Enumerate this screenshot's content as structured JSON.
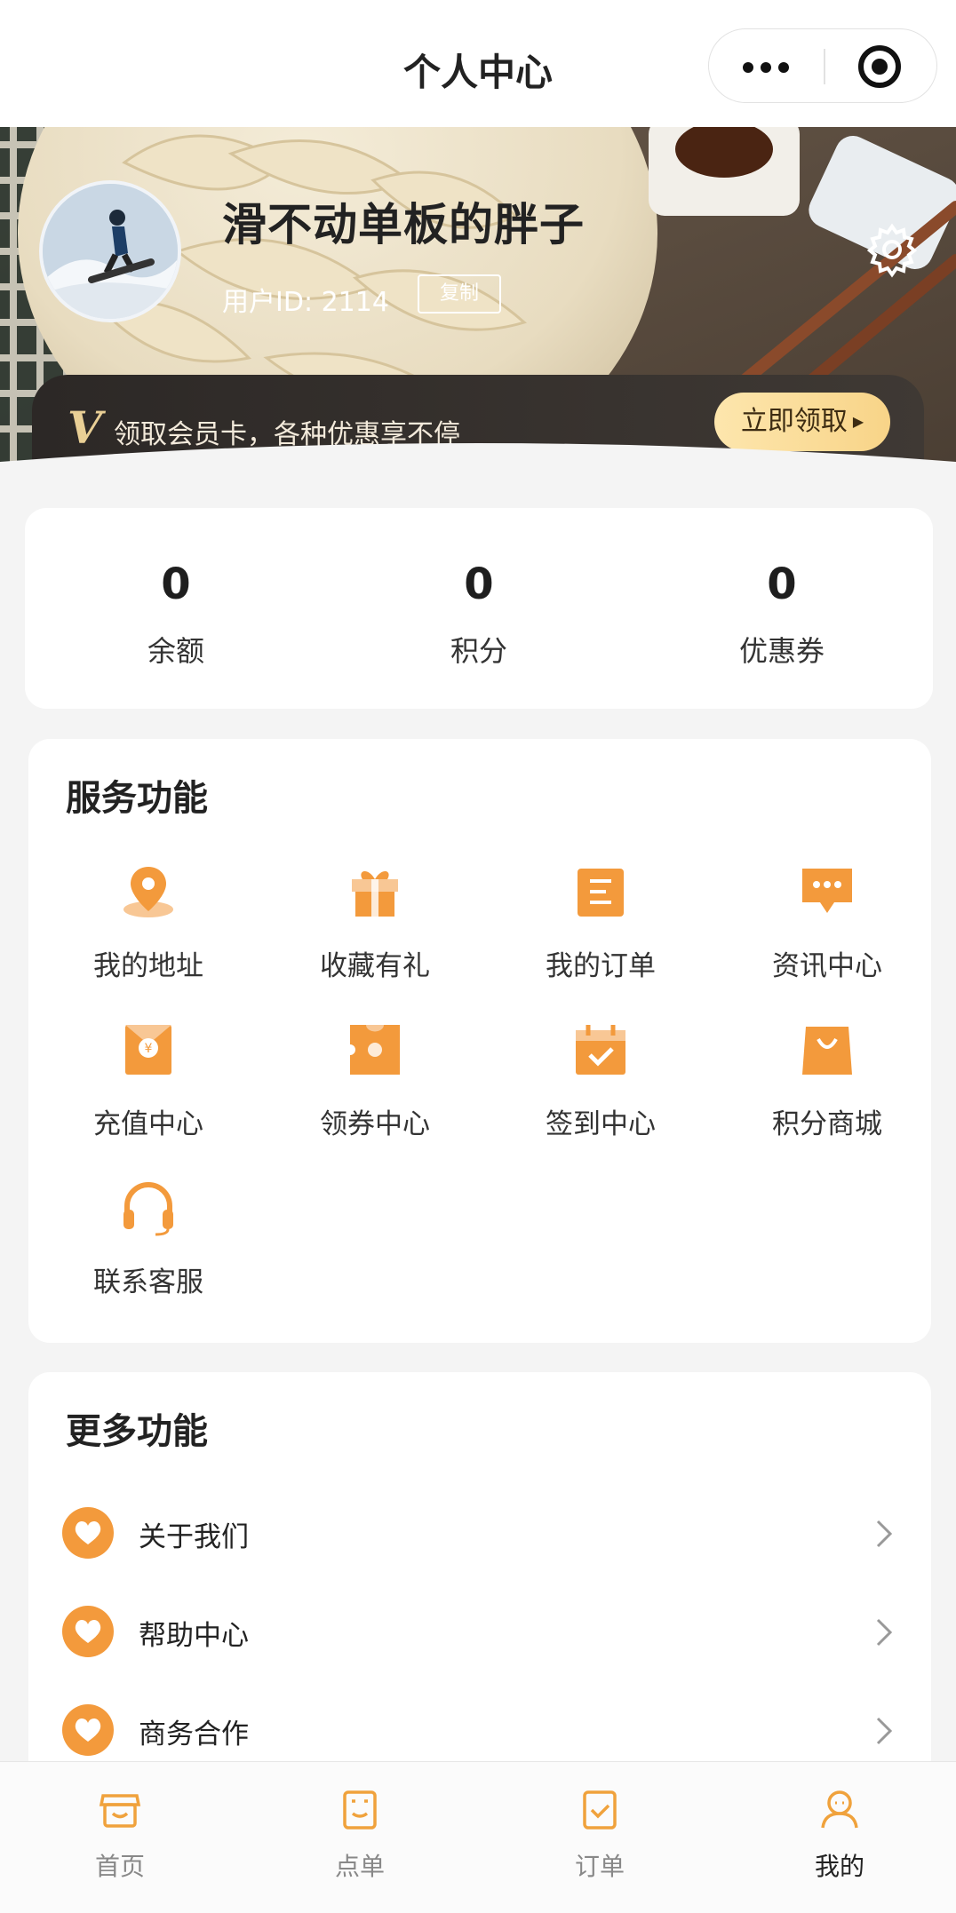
{
  "header": {
    "title": "个人中心"
  },
  "profile": {
    "nickname": "滑不动单板的胖子",
    "user_id_text": "用户ID: 2114",
    "copy_label": "复制"
  },
  "member_banner": {
    "badge": "V",
    "text": "领取会员卡，各种优惠享不停",
    "button_label": "立即领取"
  },
  "stats": [
    {
      "value": "0",
      "label": "余额"
    },
    {
      "value": "0",
      "label": "积分"
    },
    {
      "value": "0",
      "label": "优惠券"
    }
  ],
  "services": {
    "title": "服务功能",
    "items": [
      {
        "label": "我的地址",
        "icon": "location-pin-icon"
      },
      {
        "label": "收藏有礼",
        "icon": "gift-box-icon"
      },
      {
        "label": "我的订单",
        "icon": "order-list-icon"
      },
      {
        "label": "资讯中心",
        "icon": "chat-bubble-icon"
      },
      {
        "label": "充值中心",
        "icon": "recharge-envelope-icon"
      },
      {
        "label": "领券中心",
        "icon": "coupon-ticket-icon"
      },
      {
        "label": "签到中心",
        "icon": "calendar-check-icon"
      },
      {
        "label": "积分商城",
        "icon": "shopping-bag-icon"
      },
      {
        "label": "联系客服",
        "icon": "headset-icon"
      }
    ]
  },
  "more": {
    "title": "更多功能",
    "items": [
      {
        "label": "关于我们"
      },
      {
        "label": "帮助中心"
      },
      {
        "label": "商务合作"
      }
    ]
  },
  "tabbar": [
    {
      "label": "首页",
      "icon": "home-store-icon",
      "active": false
    },
    {
      "label": "点单",
      "icon": "menu-order-icon",
      "active": false
    },
    {
      "label": "订单",
      "icon": "order-check-icon",
      "active": false
    },
    {
      "label": "我的",
      "icon": "profile-icon",
      "active": true
    }
  ],
  "colors": {
    "accent": "#f39a3c",
    "gold_button": "#f8d488",
    "member_bg": "#2c2826"
  }
}
